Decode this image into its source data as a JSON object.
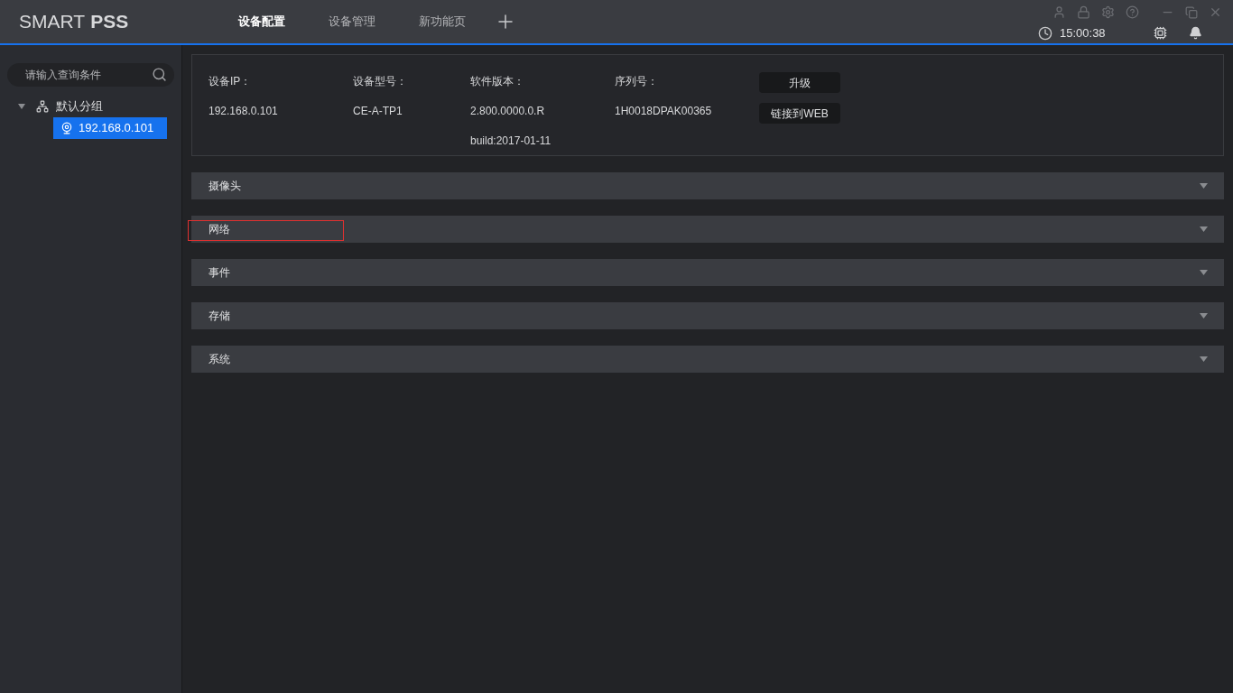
{
  "header": {
    "logo": {
      "light": "SMART",
      "bold": "PSS"
    },
    "tabs": [
      {
        "label": "设备配置",
        "selected": true
      },
      {
        "label": "设备管理",
        "selected": false
      },
      {
        "label": "新功能页",
        "selected": false
      }
    ],
    "clock": "15:00:38"
  },
  "sidebar": {
    "search": {
      "placeholder": "请输入查询条件"
    },
    "tree": [
      {
        "label": "默认分组",
        "expanded": true,
        "children": [
          {
            "label": "192.168.0.101",
            "selected": true
          }
        ]
      }
    ]
  },
  "device_info": {
    "fields": [
      {
        "label": "设备IP：",
        "values": [
          "192.168.0.101"
        ]
      },
      {
        "label": "设备型号：",
        "values": [
          "CE-A-TP1"
        ]
      },
      {
        "label": "软件版本：",
        "values": [
          "2.800.0000.0.R",
          "build:2017-01-11"
        ]
      },
      {
        "label": "序列号：",
        "values": [
          "1H0018DPAK00365"
        ]
      }
    ],
    "buttons": [
      "升级",
      "链接到WEB"
    ]
  },
  "sections": [
    {
      "label": "摄像头",
      "expanded": false,
      "highlighted": false
    },
    {
      "label": "网络",
      "expanded": false,
      "highlighted": true
    },
    {
      "label": "事件",
      "expanded": false,
      "highlighted": false
    },
    {
      "label": "存储",
      "expanded": false,
      "highlighted": false
    },
    {
      "label": "系统",
      "expanded": false,
      "highlighted": false
    }
  ]
}
